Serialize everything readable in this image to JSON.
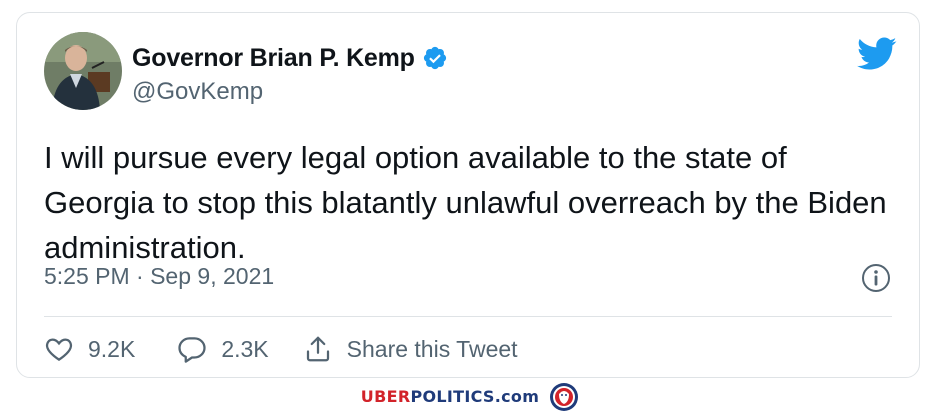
{
  "tweet": {
    "author_name": "Governor Brian P. Kemp",
    "handle": "@GovKemp",
    "text": "I will pursue every legal option available to the state of Georgia to stop this blatantly unlawful overreach by the Biden administration.",
    "timestamp": "5:25 PM · Sep 9, 2021",
    "verified": true
  },
  "actions": {
    "likes": "9.2K",
    "replies": "2.3K",
    "share_label": "Share this Tweet"
  },
  "icons": {
    "brand": "twitter-bird-icon",
    "verified": "verified-badge-icon",
    "info": "info-icon",
    "like": "heart-icon",
    "reply": "reply-bubble-icon",
    "share": "share-icon"
  },
  "colors": {
    "twitter_blue": "#1d9bf0",
    "text_primary": "#0f1419",
    "text_secondary": "#536471",
    "brand_red": "#d2232a",
    "brand_blue": "#1f3b7a"
  },
  "footer": {
    "brand_uber": "UBER",
    "brand_politics": "POLITICS",
    "brand_domain": ".com"
  }
}
